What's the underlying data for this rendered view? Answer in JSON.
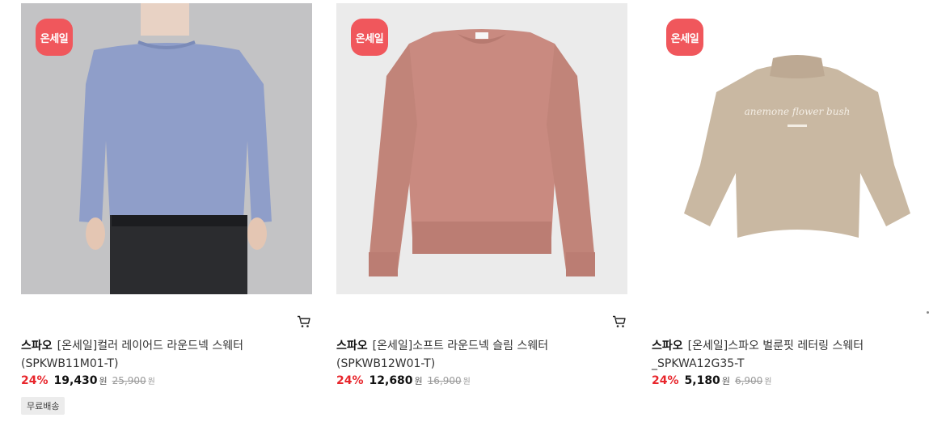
{
  "products": [
    {
      "badge": "온세일",
      "brand": "스파오",
      "name": "[온세일]컬러 레이어드 라운드넥 스웨터 (SPKWB11M01-T)",
      "discount_rate": "24%",
      "price": "19,430",
      "currency": "원",
      "original_price": "25,900",
      "original_currency": "원",
      "tag": "무료배송",
      "image_colors": {
        "background": "#c3c3c5",
        "sweater": "#8f9ec9"
      }
    },
    {
      "badge": "온세일",
      "brand": "스파오",
      "name": "[온세일]소프트 라운드넥 슬림 스웨터 (SPKWB12W01-T)",
      "discount_rate": "24%",
      "price": "12,680",
      "currency": "원",
      "original_price": "16,900",
      "original_currency": "원",
      "image_colors": {
        "background": "#ebebeb",
        "sweater": "#c98a80"
      }
    },
    {
      "badge": "온세일",
      "brand": "스파오",
      "name": "[온세일]스파오 벌룬핏 레터링 스웨터 _SPKWA12G35-T",
      "discount_rate": "24%",
      "price": "5,180",
      "currency": "원",
      "original_price": "6,900",
      "original_currency": "원",
      "image_text": "anemone flower bush",
      "image_colors": {
        "background": "#ffffff",
        "sweater": "#c9b8a2"
      }
    }
  ],
  "icons": {
    "cart": "cart-icon"
  },
  "colors": {
    "badge": "#f0575c",
    "discount": "#e8262c"
  }
}
